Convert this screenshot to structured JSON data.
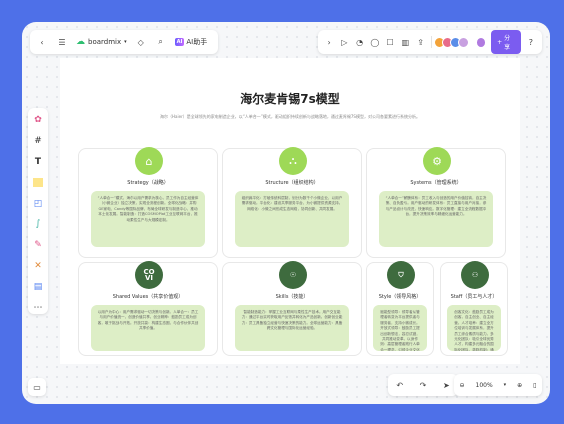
{
  "topbar": {
    "brand": "boardmix",
    "ai_label": "AI助手",
    "ai_badge": "AI",
    "share_label": "分享"
  },
  "canvas": {
    "title": "海尔麦肯锡7s模型",
    "subtitle": "海尔（Haier）是全球领先的家电制造企业，以“人单合一”模式，驱动组织持续创新与战略落地，通过麦肯锡7S模型，对公司各要素进行系统分析。",
    "cards": [
      {
        "name": "Strategy（战略）",
        "desc": "“人单合一”模式，海尔以用户需求为核心，员工作为自主经营体（小微企业）独立决策，实现全流程创新。全球化战略：并购GE家电、Candy等国际品牌，布局全球研发与制造中心，推动本土化发展。智能制造：打造COSMOPlat工业互联网平台，推动柔性生产与大规模定制。"
      },
      {
        "name": "Structure（组织结构）",
        "desc": "组织扁平化：打破传统科层制，划分为数千个小微企业，以用户需求驱动。平台化：建设共享服务平台，为小微提供资源支持。网络化：小微之间形成生态网络，协同创新、共同发展。"
      },
      {
        "name": "Systems（管理系统）",
        "desc": "“人单合一”薪酬体系：员工收入与创造的用户价值挂钩，自主决策、自负盈亏。用户驱动的研发体系：员工直接与用户对接，参与产品设计与改进，快速响应。数字化管理：建立全流程数据中台，提升决策效率与精细化运营能力。"
      },
      {
        "name": "Shared Values（共享价值观）",
        "desc": "以用户为中心：用户需求驱动一切决策与创新。人单合一：员工与用户价值统一，创造价值共享。创业精神：鼓励员工成为创客，敢于挑战与开拓。开放共赢：构建生态圈，与合作伙伴共创共享价值。"
      },
      {
        "name": "Skills（技能）",
        "desc": "智能制造能力：掌握工业互联网与柔性生产技术。用户交互能力：通过平台实时获取用户反馈并转化为产品创新。创新创业能力：员工具备独立经营与快速决策的能力。全球运营能力：具备跨文化管理与国际化运营经验。"
      },
      {
        "name": "Style（领导风格）",
        "desc": "赋能型领导：领导者从管理者转变为平台提供者与服务者，支持小微成长。开放式领导：鼓励员工提出创新想法，容忍试错，共同推动变革。以身作则：高层管理者践行人单合一理念，引领企业文化与战略方向。"
      },
      {
        "name": "Staff（员工与人才）",
        "desc": "创客文化：鼓励员工成为创客，自主创业、自主经营。人才培养：建立全方位培训与发展体系，提升员工综合素质与能力。多元化团队：吸引全球优秀人才，构建多元融合的国际化团队。激励机制：通过股权激励与利益共享，激发员工创造力与积极性。"
      }
    ]
  },
  "zoom": {
    "level": "100%"
  },
  "colors": {
    "light_green": "#9ed957",
    "dark_green": "#3e6b3e",
    "panel_green": "#ddeec6",
    "accent": "#7b5cf0",
    "frame_bg": "#4e70e8"
  }
}
